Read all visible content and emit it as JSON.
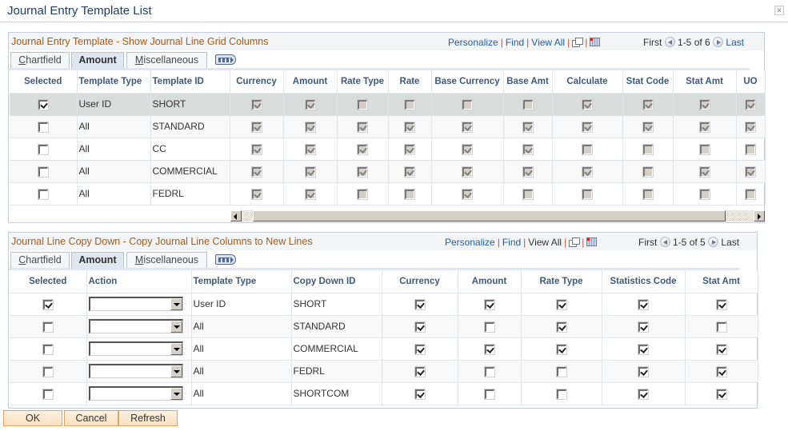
{
  "window": {
    "title": "Journal Entry Template List",
    "close_icon": "close-icon"
  },
  "top_grid": {
    "title": "Journal Entry Template - Show Journal Line Grid Columns",
    "nav": {
      "personalize": "Personalize",
      "find": "Find",
      "view_all": "View All",
      "first": "First",
      "range": "1-5 of 6",
      "last": "Last"
    },
    "tabs": [
      {
        "label": "Chartfield",
        "accesskey": "C",
        "rest": "hartfield",
        "active": false
      },
      {
        "label": "Amount",
        "active": true
      },
      {
        "label": "Miscellaneous",
        "accesskey": "M",
        "rest": "iscellaneous",
        "active": false
      }
    ],
    "columns": [
      "Selected",
      "Template Type",
      "Template ID",
      "Currency",
      "Amount",
      "Rate Type",
      "Rate",
      "Base Currency",
      "Base Amt",
      "Calculate",
      "Stat Code",
      "Stat Amt",
      "UO"
    ],
    "rows": [
      {
        "selected": true,
        "template_type": "User ID",
        "template_id": "SHORT",
        "flags": [
          true,
          true,
          false,
          false,
          false,
          false,
          true,
          true,
          true,
          true
        ]
      },
      {
        "selected": false,
        "template_type": "All",
        "template_id": "STANDARD",
        "flags": [
          true,
          true,
          true,
          true,
          true,
          true,
          true,
          true,
          true,
          true
        ]
      },
      {
        "selected": false,
        "template_type": "All",
        "template_id": "CC",
        "flags": [
          true,
          true,
          true,
          true,
          true,
          true,
          false,
          false,
          false,
          false
        ]
      },
      {
        "selected": false,
        "template_type": "All",
        "template_id": "COMMERCIAL",
        "flags": [
          true,
          true,
          true,
          true,
          true,
          true,
          true,
          false,
          true,
          true
        ]
      },
      {
        "selected": false,
        "template_type": "All",
        "template_id": "FEDRL",
        "flags": [
          true,
          true,
          false,
          false,
          true,
          false,
          false,
          false,
          false,
          false
        ]
      }
    ]
  },
  "bottom_grid": {
    "title": "Journal Line Copy Down - Copy Journal Line Columns to New Lines",
    "nav": {
      "personalize": "Personalize",
      "find": "Find",
      "view_all": "View All",
      "first": "First",
      "range": "1-5 of 5",
      "last": "Last"
    },
    "tabs": [
      {
        "label": "Chartfield",
        "accesskey": "C",
        "rest": "hartfield",
        "active": false
      },
      {
        "label": "Amount",
        "active": true
      },
      {
        "label": "Miscellaneous",
        "accesskey": "M",
        "rest": "iscellaneous",
        "active": false
      }
    ],
    "columns": [
      "Selected",
      "Action",
      "Template Type",
      "Copy Down ID",
      "Currency",
      "Amount",
      "Rate Type",
      "Statistics Code",
      "Stat Amt"
    ],
    "rows": [
      {
        "selected": true,
        "action": "",
        "template_type": "User ID",
        "copy_down_id": "SHORT",
        "flags": [
          true,
          true,
          true,
          true,
          true
        ]
      },
      {
        "selected": false,
        "action": "",
        "template_type": "All",
        "copy_down_id": "STANDARD",
        "flags": [
          true,
          false,
          true,
          true,
          false
        ]
      },
      {
        "selected": false,
        "action": "",
        "template_type": "All",
        "copy_down_id": "COMMERCIAL",
        "flags": [
          true,
          true,
          true,
          true,
          true
        ]
      },
      {
        "selected": false,
        "action": "",
        "template_type": "All",
        "copy_down_id": "FEDRL",
        "flags": [
          true,
          false,
          false,
          true,
          true
        ]
      },
      {
        "selected": false,
        "action": "",
        "template_type": "All",
        "copy_down_id": "SHORTCOM",
        "flags": [
          true,
          false,
          false,
          true,
          true
        ]
      }
    ]
  },
  "buttons": {
    "ok": "OK",
    "cancel": "Cancel",
    "refresh": "Refresh"
  },
  "colors": {
    "grid_title": "#a55a16",
    "link": "#1f5fa8",
    "header_text": "#3d5a7d",
    "selected_row": "#d8dcdb",
    "button_border": "#d8a468"
  }
}
